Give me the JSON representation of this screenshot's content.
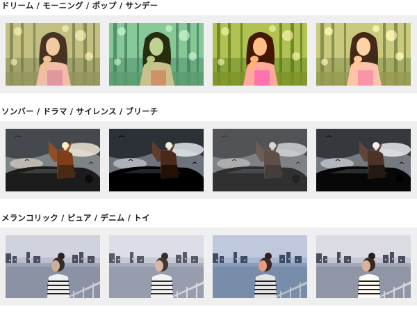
{
  "sections": [
    {
      "title": "ドリーム / モーニング / ポップ / サンデー",
      "filters": [
        "ドリーム",
        "モーニング",
        "ポップ",
        "サンデー"
      ]
    },
    {
      "title": "ソンバー / ドラマ / サイレンス / ブリーチ",
      "filters": [
        "ソンバー",
        "ドラマ",
        "サイレンス",
        "ブリーチ"
      ]
    },
    {
      "title": "メランコリック / ピュア / デニム / トイ",
      "filters": [
        "メランコリック",
        "ピュア",
        "デニム",
        "トイ"
      ]
    }
  ]
}
